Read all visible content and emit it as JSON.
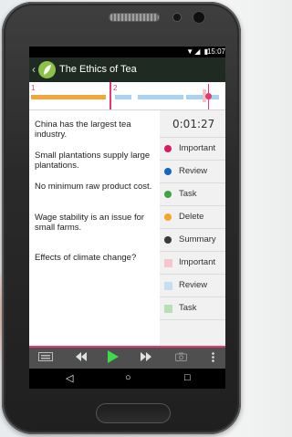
{
  "status_bar": {
    "icons": "▼◢ ▮",
    "time": "15:07"
  },
  "app_bar": {
    "title": "The Ethics of Tea"
  },
  "timeline": {
    "segments": [
      {
        "number": "1"
      },
      {
        "number": "2"
      }
    ]
  },
  "timer": "0:01:27",
  "notes": [
    "China has the largest tea industry.",
    "Small plantations supply large plantations.",
    "No minimum raw product cost.",
    "Wage stability is an issue for small farms.",
    "Effects of climate change?"
  ],
  "tags": [
    {
      "label": "Important",
      "color": "#d81b60",
      "shape": "dot"
    },
    {
      "label": "Review",
      "color": "#1565c0",
      "shape": "dot"
    },
    {
      "label": "Task",
      "color": "#43a047",
      "shape": "dot"
    },
    {
      "label": "Delete",
      "color": "#f5a623",
      "shape": "dot"
    },
    {
      "label": "Summary",
      "color": "#3a3a3a",
      "shape": "dot"
    },
    {
      "label": "Important",
      "color": "#f7c6cc",
      "shape": "square"
    },
    {
      "label": "Review",
      "color": "#c7ddf2",
      "shape": "square"
    },
    {
      "label": "Task",
      "color": "#b9e0b4",
      "shape": "square"
    }
  ],
  "toolbar": {
    "icons": [
      "keyboard-icon",
      "rewind-icon",
      "play-icon",
      "fast-forward-icon",
      "camera-icon",
      "overflow-menu-icon"
    ],
    "accent": "#3ddc4a"
  },
  "nav": {
    "back": "◁",
    "home": "○",
    "recents": "□"
  }
}
